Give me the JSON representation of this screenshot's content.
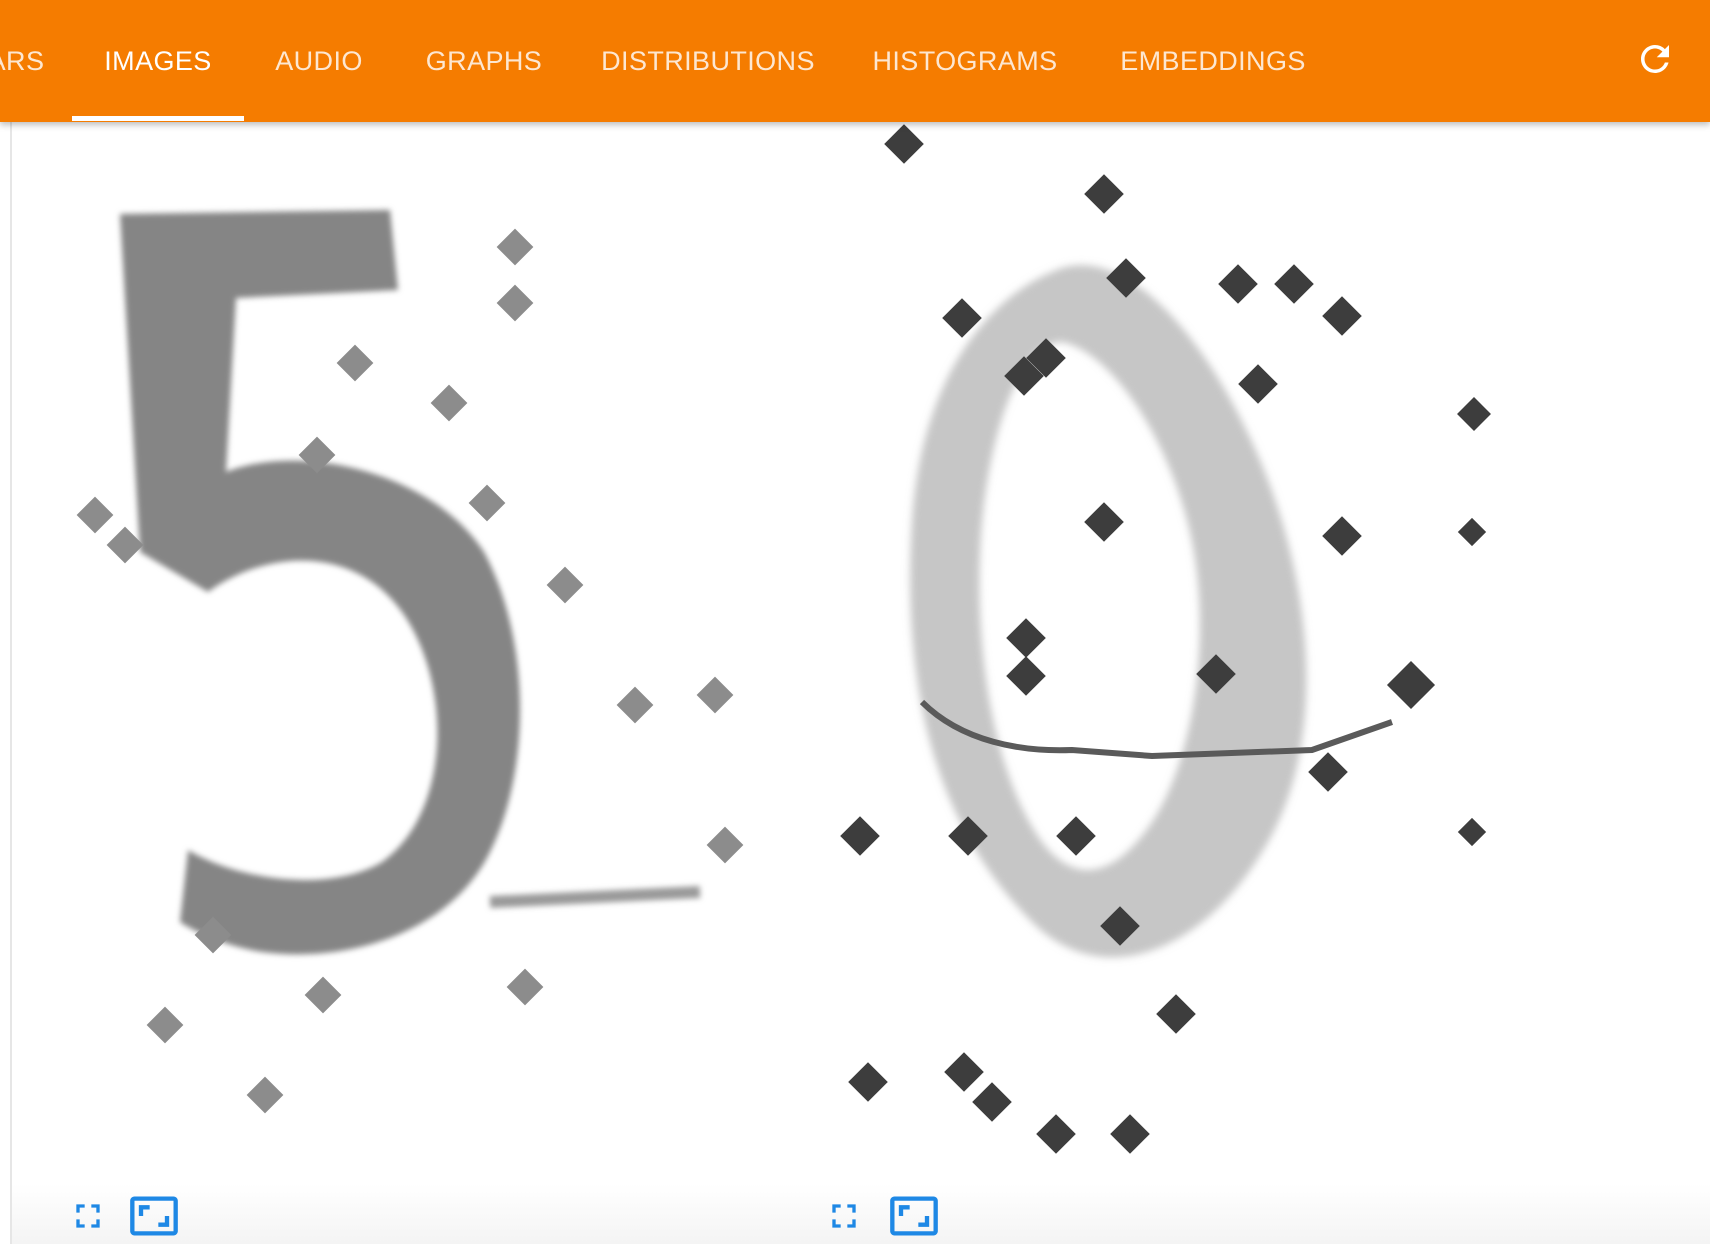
{
  "colors": {
    "header_bg": "#f57c00",
    "header_text": "#ffffff",
    "icon_accent": "#1e88e5",
    "digit_dark": "#808080",
    "digit_light": "#c8c8c8",
    "dot_dark": "#3c3c3c"
  },
  "nav": {
    "tabs": [
      {
        "label": "ARS",
        "active": false
      },
      {
        "label": "IMAGES",
        "active": true
      },
      {
        "label": "AUDIO",
        "active": false
      },
      {
        "label": "GRAPHS",
        "active": false
      },
      {
        "label": "DISTRIBUTIONS",
        "active": false
      },
      {
        "label": "HISTOGRAMS",
        "active": false
      },
      {
        "label": "EMBEDDINGS",
        "active": false
      }
    ],
    "refresh_icon": "refresh-icon"
  },
  "cards": [
    {
      "digit_shown": "5",
      "style": "gray-noisy",
      "actions": {
        "fullscreen_icon": "fullscreen-icon",
        "actual_size_icon": "aspect-ratio-icon"
      }
    },
    {
      "digit_shown": "0",
      "style": "light-with-dark-noise",
      "actions": {
        "fullscreen_icon": "fullscreen-icon",
        "actual_size_icon": "aspect-ratio-icon"
      }
    }
  ]
}
